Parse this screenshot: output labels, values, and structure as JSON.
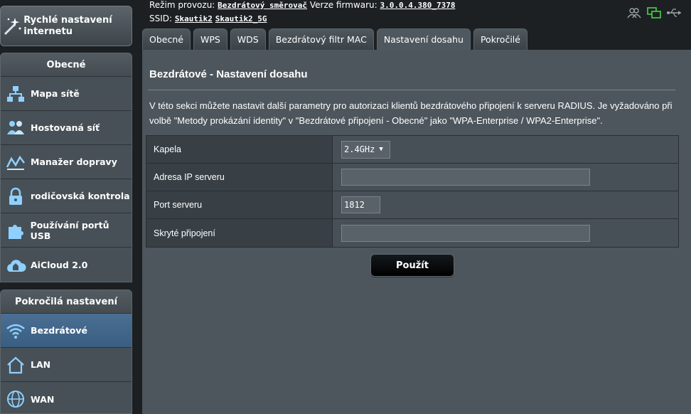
{
  "sidebar": {
    "quick_setup": "Rychlé nastavení internetu",
    "general": {
      "title": "Obecné",
      "items": [
        {
          "label": "Mapa sítě",
          "icon": "network-map-icon"
        },
        {
          "label": "Hostovaná síť",
          "icon": "guest-network-icon"
        },
        {
          "label": "Manažer dopravy",
          "icon": "traffic-manager-icon"
        },
        {
          "label": "rodičovská kontrola",
          "icon": "parental-control-icon"
        },
        {
          "label": "Používání portů USB",
          "icon": "usb-application-icon"
        },
        {
          "label": "AiCloud 2.0",
          "icon": "aicloud-icon"
        }
      ]
    },
    "advanced": {
      "title": "Pokročilá nastavení",
      "items": [
        {
          "label": "Bezdrátové",
          "icon": "wireless-icon",
          "active": true
        },
        {
          "label": "LAN",
          "icon": "lan-icon"
        },
        {
          "label": "WAN",
          "icon": "wan-icon"
        }
      ]
    }
  },
  "header": {
    "mode_label": "Režim provozu:",
    "mode_value": "Bezdrátový směrovač",
    "firmware_label": "Verze firmwaru:",
    "firmware_value": "3.0.0.4.380_7378",
    "ssid_label": "SSID:",
    "ssid_values": [
      "Skautik2",
      "Skautik2_5G"
    ]
  },
  "tabs": [
    {
      "label": "Obecné"
    },
    {
      "label": "WPS"
    },
    {
      "label": "WDS"
    },
    {
      "label": "Bezdrátový filtr MAC"
    },
    {
      "label": "Nastavení dosahu",
      "active": true
    },
    {
      "label": "Pokročilé"
    }
  ],
  "main": {
    "title": "Bezdrátové - Nastavení dosahu",
    "description": "V této sekci můžete nastavit další parametry pro autorizaci klientů bezdrátového připojení k serveru RADIUS. Je vyžadováno při volbě \"Metody prokázání identity\" v \"Bezdrátové připojení - Obecné\" jako \"WPA-Enterprise / WPA2-Enterprise\".",
    "fields": {
      "band_label": "Kapela",
      "band_value": "2.4GHz",
      "server_ip_label": "Adresa IP serveru",
      "server_ip_value": "",
      "server_port_label": "Port serveru",
      "server_port_value": "1812",
      "secret_label": "Skryté připojení",
      "secret_value": ""
    },
    "apply_button": "Použít"
  },
  "colors": {
    "active_nav": "#3f6488",
    "panel": "#4d565c",
    "status_green": "#4ad24a"
  }
}
